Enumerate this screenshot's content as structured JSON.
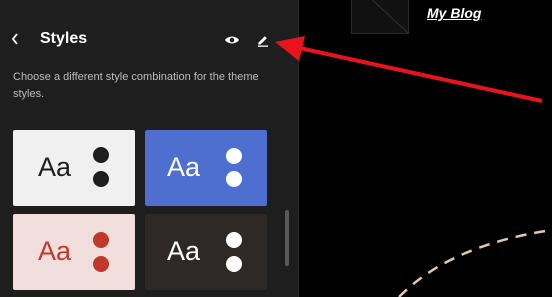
{
  "sidebar": {
    "title": "Styles",
    "back_icon": "chevron-left-icon",
    "preview_icon": "eye-icon",
    "edit_icon": "pencil-icon",
    "description": "Choose a different style combination for the theme styles."
  },
  "variations": [
    {
      "label": "Aa",
      "background": "#f0f0f0",
      "text_color": "#1e1e1e",
      "dot_color": "#1e1e1e",
      "selected": false
    },
    {
      "label": "Aa",
      "background": "#4e6fcf",
      "text_color": "#ffffff",
      "dot_color": "#ffffff",
      "selected": true
    },
    {
      "label": "Aa",
      "background": "#f3dede",
      "text_color": "#c0392b",
      "dot_color": "#c0392b",
      "selected": false
    },
    {
      "label": "Aa",
      "background": "#2e2826",
      "text_color": "#ffffff",
      "dot_color": "#ffffff",
      "selected": false
    }
  ],
  "canvas": {
    "site_title": "My Blog"
  },
  "annotation": {
    "arrow_color": "#e8141b",
    "dashed_curve_color": "#e6c7a6"
  }
}
